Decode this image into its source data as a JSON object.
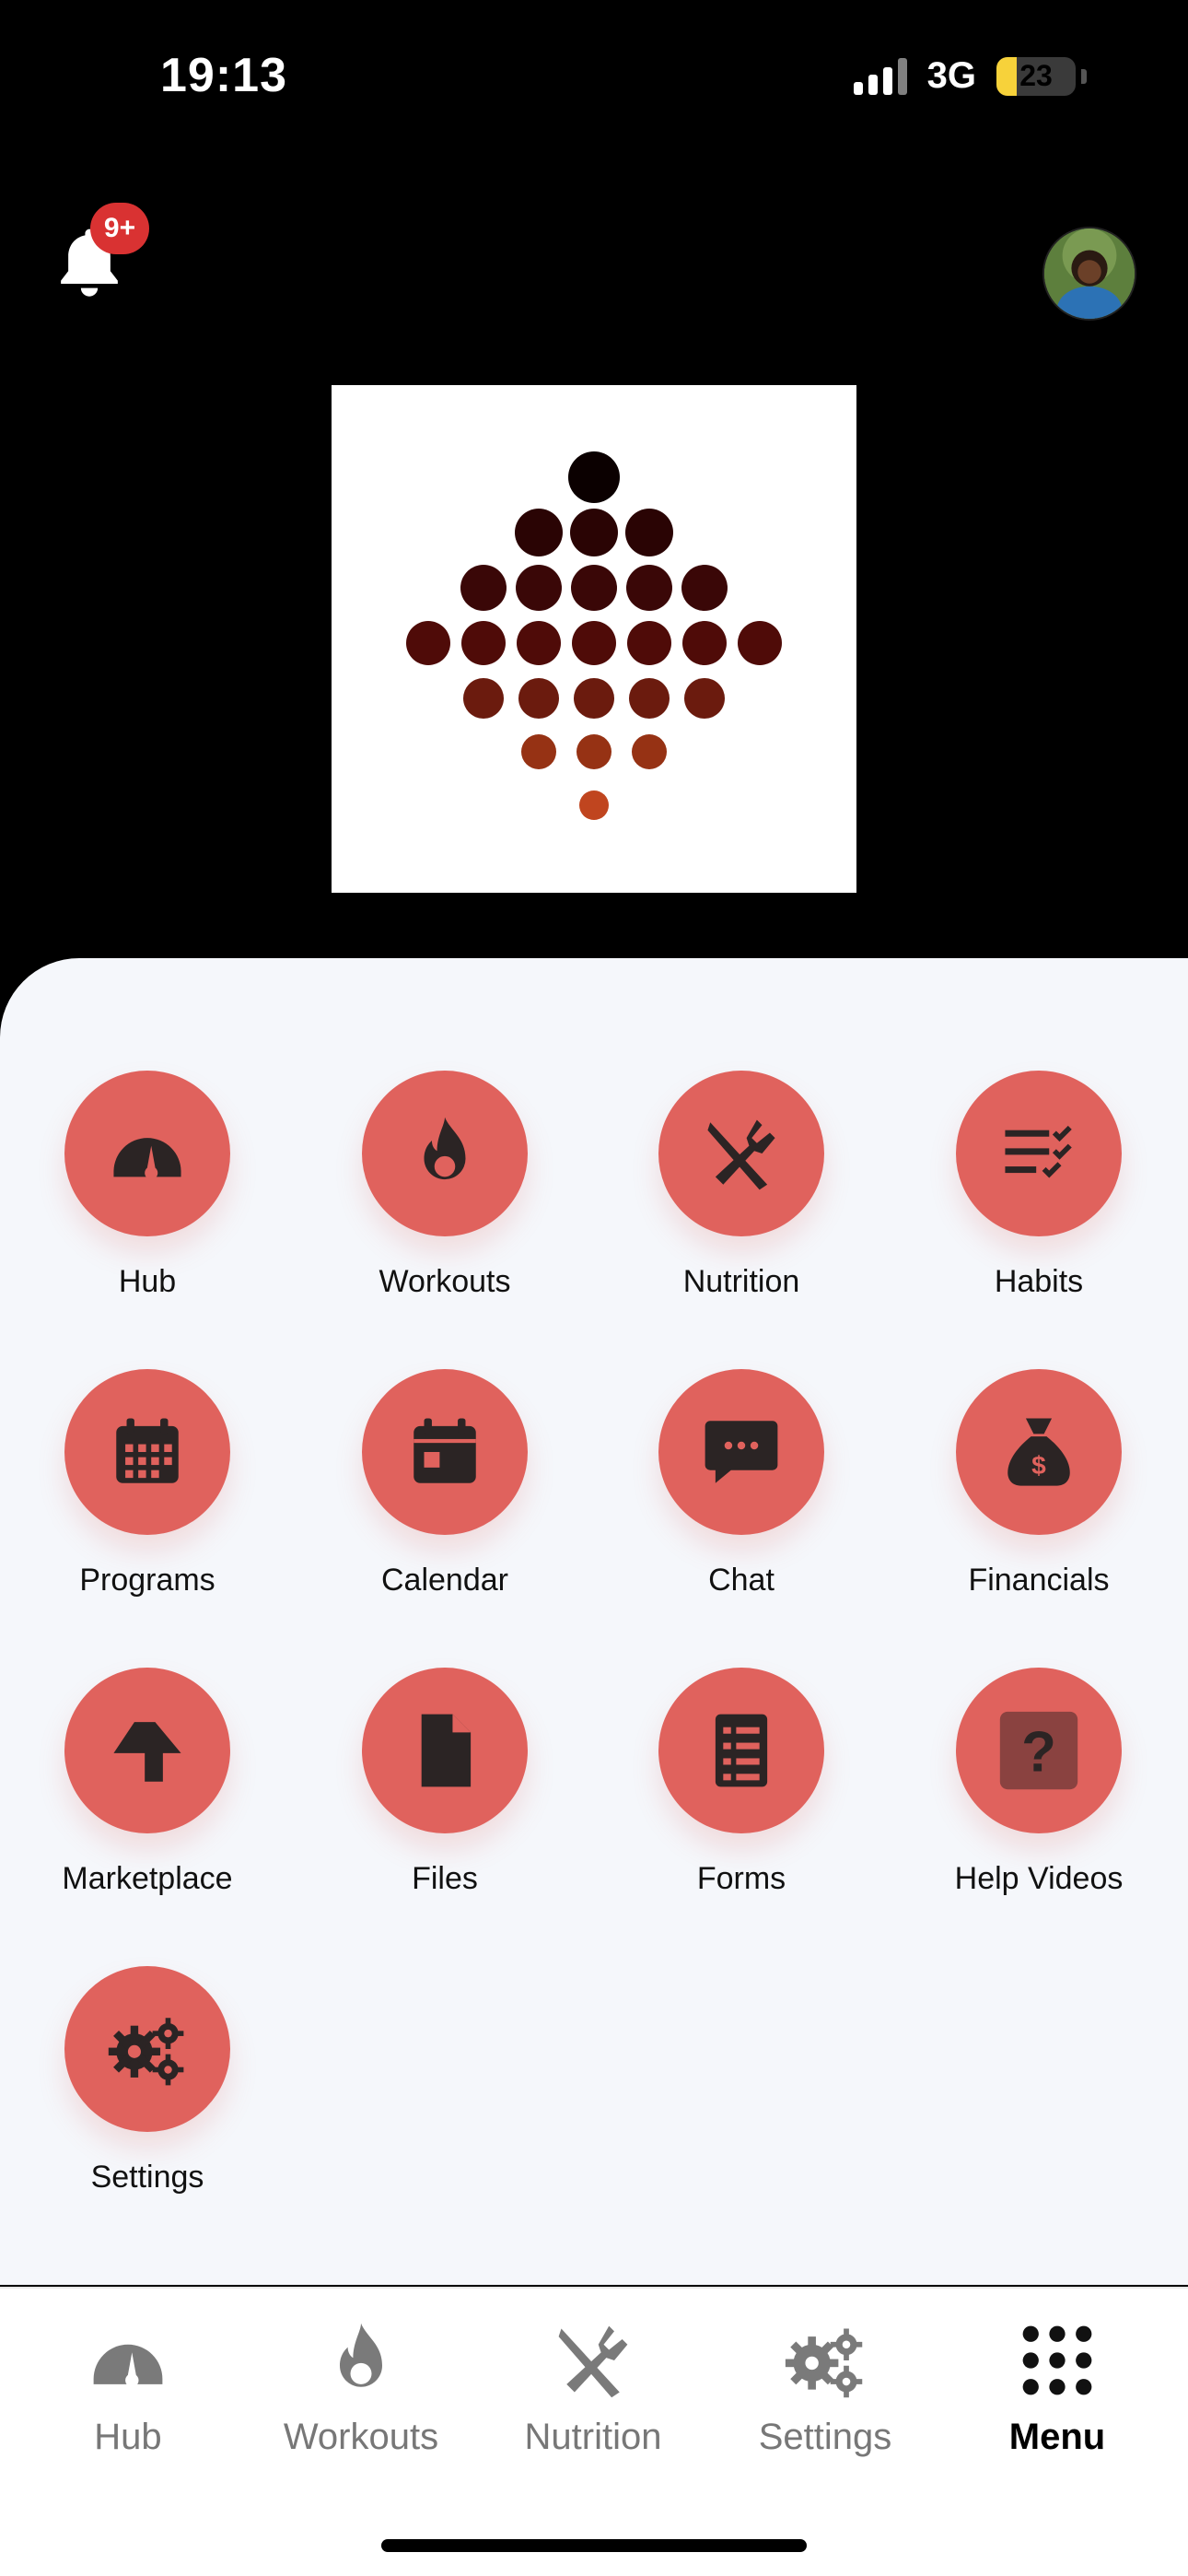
{
  "status_bar": {
    "time": "19:13",
    "network": "3G",
    "battery": "23"
  },
  "header": {
    "notification_badge": "9+"
  },
  "menu": {
    "tiles": [
      {
        "label": "Hub",
        "icon": "speedometer-icon"
      },
      {
        "label": "Workouts",
        "icon": "flame-icon"
      },
      {
        "label": "Nutrition",
        "icon": "fork-knife-icon"
      },
      {
        "label": "Habits",
        "icon": "checklist-icon"
      },
      {
        "label": "Programs",
        "icon": "calendar-grid-icon"
      },
      {
        "label": "Calendar",
        "icon": "calendar-icon"
      },
      {
        "label": "Chat",
        "icon": "chat-bubble-icon"
      },
      {
        "label": "Financials",
        "icon": "money-bag-icon"
      },
      {
        "label": "Marketplace",
        "icon": "arrow-turn-icon"
      },
      {
        "label": "Files",
        "icon": "file-icon"
      },
      {
        "label": "Forms",
        "icon": "form-list-icon"
      },
      {
        "label": "Help Videos",
        "icon": "question-icon"
      },
      {
        "label": "Settings",
        "icon": "gears-icon"
      }
    ]
  },
  "tabbar": {
    "tabs": [
      {
        "label": "Hub",
        "icon": "speedometer-icon"
      },
      {
        "label": "Workouts",
        "icon": "flame-icon"
      },
      {
        "label": "Nutrition",
        "icon": "fork-knife-icon"
      },
      {
        "label": "Settings",
        "icon": "gears-icon"
      },
      {
        "label": "Menu",
        "icon": "grid-dots-icon",
        "active": true
      }
    ]
  },
  "colors": {
    "accent": "#e0625d",
    "icon_dark": "#2b2424",
    "panel_bg": "#f5f7fb",
    "tab_icon": "#7a7a7a"
  }
}
